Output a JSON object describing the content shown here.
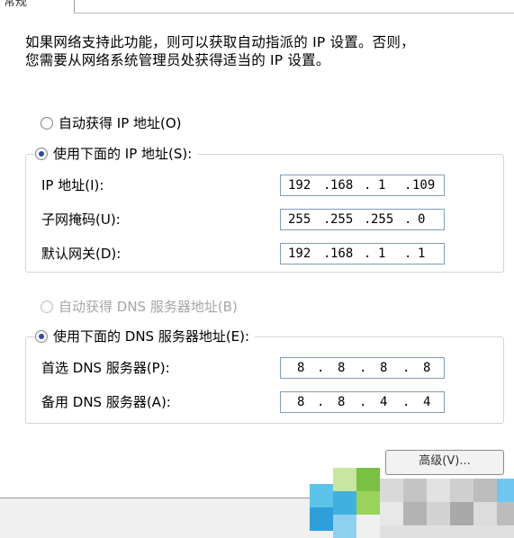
{
  "tab": {
    "label": "常规"
  },
  "description": {
    "line1": "如果网络支持此功能，则可以获取自动指派的 IP 设置。否则，",
    "line2": "您需要从网络系统管理员处获得适当的 IP 设置。"
  },
  "ip": {
    "auto_label": "自动获得 IP 地址(O)",
    "manual_label": "使用下面的 IP 地址(S):",
    "fields": [
      {
        "label": "IP 地址(I):",
        "octets": [
          "192",
          "168",
          "1",
          "109"
        ]
      },
      {
        "label": "子网掩码(U):",
        "octets": [
          "255",
          "255",
          "255",
          "0"
        ]
      },
      {
        "label": "默认网关(D):",
        "octets": [
          "192",
          "168",
          "1",
          "1"
        ]
      }
    ]
  },
  "dns": {
    "auto_label": "自动获得 DNS 服务器地址(B)",
    "manual_label": "使用下面的 DNS 服务器地址(E):",
    "fields": [
      {
        "label": "首选 DNS 服务器(P):",
        "octets": [
          "8",
          "8",
          "8",
          "8"
        ]
      },
      {
        "label": "备用 DNS 服务器(A):",
        "octets": [
          "8",
          "8",
          "4",
          "4"
        ]
      }
    ]
  },
  "advanced_button": "高级(V)...",
  "colors": {
    "radio_dot": "#2a4da8",
    "input_border": "#7f9db9",
    "disabled_text": "#a6a6a6"
  }
}
